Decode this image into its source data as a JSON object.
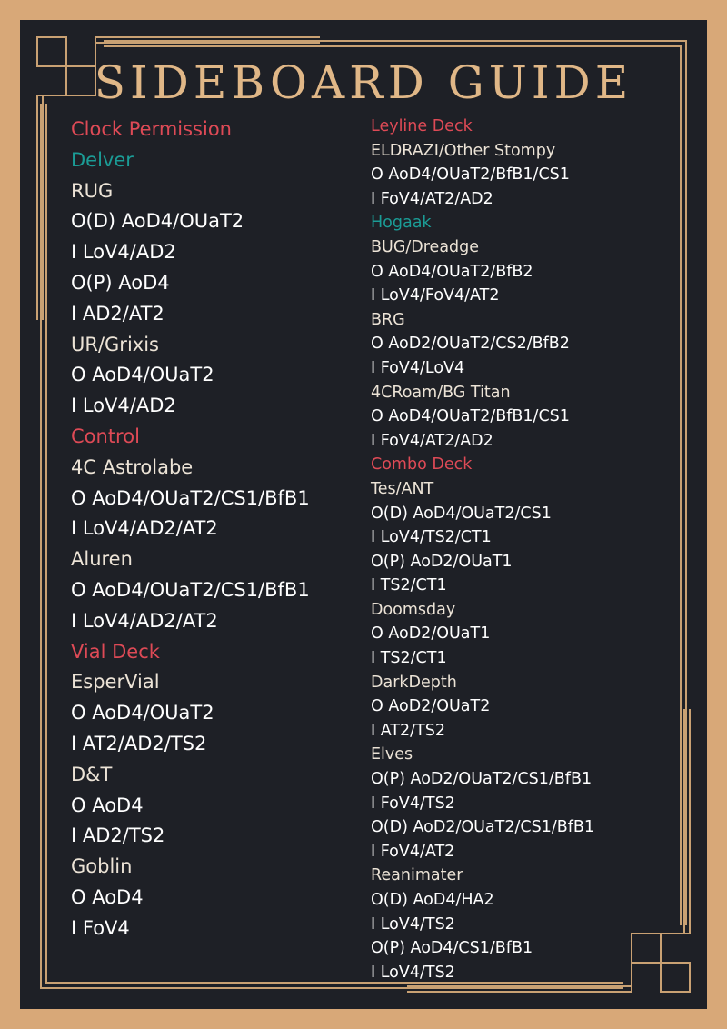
{
  "title": "SIDEBOARD GUIDE",
  "colors": {
    "page_border": "#d8a878",
    "panel_background": "#1e2026",
    "frame": "#c9a173",
    "title": "#e0b787",
    "section_header": "#de4a56",
    "sub_header": "#1b9c96",
    "deck_name": "#ece3d6",
    "swap_line": "#ffffff"
  },
  "left_column": [
    {
      "kind": "section",
      "text": "Clock Permission"
    },
    {
      "kind": "sub",
      "text": "Delver"
    },
    {
      "kind": "deck",
      "text": "RUG"
    },
    {
      "kind": "line",
      "text": "O(D) AoD4/OUaT2"
    },
    {
      "kind": "line",
      "text": "I  LoV4/AD2"
    },
    {
      "kind": "line",
      "text": "O(P) AoD4"
    },
    {
      "kind": "line",
      "text": "I  AD2/AT2"
    },
    {
      "kind": "deck",
      "text": "UR/Grixis"
    },
    {
      "kind": "line",
      "text": "O AoD4/OUaT2"
    },
    {
      "kind": "line",
      "text": "I  LoV4/AD2"
    },
    {
      "kind": "section",
      "text": "Control"
    },
    {
      "kind": "deck",
      "text": "4C Astrolabe"
    },
    {
      "kind": "line",
      "text": "O AoD4/OUaT2/CS1/BfB1"
    },
    {
      "kind": "line",
      "text": "I LoV4/AD2/AT2"
    },
    {
      "kind": "deck",
      "text": "Aluren"
    },
    {
      "kind": "line",
      "text": "O AoD4/OUaT2/CS1/BfB1"
    },
    {
      "kind": "line",
      "text": "I LoV4/AD2/AT2"
    },
    {
      "kind": "section",
      "text": "Vial Deck"
    },
    {
      "kind": "deck",
      "text": "EsperVial"
    },
    {
      "kind": "line",
      "text": "O AoD4/OUaT2"
    },
    {
      "kind": "line",
      "text": "I  AT2/AD2/TS2"
    },
    {
      "kind": "deck",
      "text": "D&T"
    },
    {
      "kind": "line",
      "text": "O AoD4"
    },
    {
      "kind": "line",
      "text": "I  AD2/TS2"
    },
    {
      "kind": "deck",
      "text": "Goblin"
    },
    {
      "kind": "line",
      "text": "O AoD4"
    },
    {
      "kind": "line",
      "text": "I FoV4"
    }
  ],
  "right_column": [
    {
      "kind": "section",
      "text": "Leyline Deck"
    },
    {
      "kind": "deck",
      "text": "ELDRAZI/Other Stompy"
    },
    {
      "kind": "line",
      "text": "O AoD4/OUaT2/BfB1/CS1"
    },
    {
      "kind": "line",
      "text": "I  FoV4/AT2/AD2"
    },
    {
      "kind": "sub",
      "text": "Hogaak"
    },
    {
      "kind": "deck",
      "text": "BUG/Dreadge"
    },
    {
      "kind": "line",
      "text": "O AoD4/OUaT2/BfB2"
    },
    {
      "kind": "line",
      "text": "I  LoV4/FoV4/AT2"
    },
    {
      "kind": "deck",
      "text": "BRG"
    },
    {
      "kind": "line",
      "text": "O AoD2/OUaT2/CS2/BfB2"
    },
    {
      "kind": "line",
      "text": "I  FoV4/LoV4"
    },
    {
      "kind": "deck",
      "text": "4CRoam/BG Titan"
    },
    {
      "kind": "line",
      "text": "O AoD4/OUaT2/BfB1/CS1"
    },
    {
      "kind": "line",
      "text": "I  FoV4/AT2/AD2"
    },
    {
      "kind": "section",
      "text": "Combo Deck"
    },
    {
      "kind": "deck",
      "text": "Tes/ANT"
    },
    {
      "kind": "line",
      "text": "O(D) AoD4/OUaT2/CS1"
    },
    {
      "kind": "line",
      "text": "I  LoV4/TS2/CT1"
    },
    {
      "kind": "line",
      "text": "O(P) AoD2/OUaT1"
    },
    {
      "kind": "line",
      "text": "I  TS2/CT1"
    },
    {
      "kind": "deck",
      "text": "Doomsday"
    },
    {
      "kind": "line",
      "text": "O AoD2/OUaT1"
    },
    {
      "kind": "line",
      "text": "I  TS2/CT1"
    },
    {
      "kind": "deck",
      "text": "DarkDepth"
    },
    {
      "kind": "line",
      "text": "O AoD2/OUaT2"
    },
    {
      "kind": "line",
      "text": "I  AT2/TS2"
    },
    {
      "kind": "deck",
      "text": "Elves"
    },
    {
      "kind": "line",
      "text": "O(P) AoD2/OUaT2/CS1/BfB1"
    },
    {
      "kind": "line",
      "text": "I  FoV4/TS2"
    },
    {
      "kind": "line",
      "text": "O(D) AoD2/OUaT2/CS1/BfB1"
    },
    {
      "kind": "line",
      "text": "I  FoV4/AT2"
    },
    {
      "kind": "deck",
      "text": "Reanimater"
    },
    {
      "kind": "line",
      "text": "O(D) AoD4/HA2"
    },
    {
      "kind": "line",
      "text": "I  LoV4/TS2"
    },
    {
      "kind": "line",
      "text": "O(P) AoD4/CS1/BfB1"
    },
    {
      "kind": "line",
      "text": "I  LoV4/TS2"
    }
  ]
}
